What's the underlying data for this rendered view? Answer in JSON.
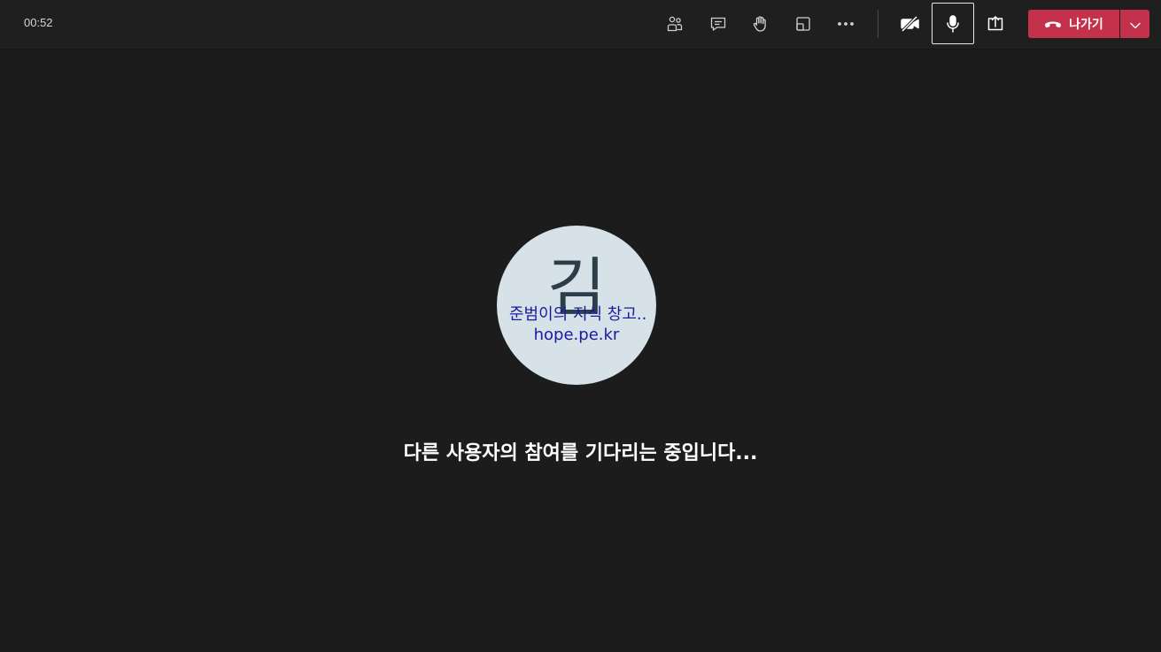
{
  "call": {
    "timer": "00:52"
  },
  "toolbar": {
    "buttons": [
      {
        "name": "show-participants",
        "icon": "people-icon"
      },
      {
        "name": "show-conversation",
        "icon": "chat-icon"
      },
      {
        "name": "raise-hand",
        "icon": "hand-icon"
      },
      {
        "name": "breakout-rooms",
        "icon": "rooms-icon"
      },
      {
        "name": "more-actions",
        "icon": "more-icon"
      },
      {
        "name": "camera-toggle",
        "icon": "camera-off-icon",
        "state": "off"
      },
      {
        "name": "mic-toggle",
        "icon": "mic-icon",
        "state": "on"
      },
      {
        "name": "share-content",
        "icon": "share-icon"
      }
    ],
    "leave_label": "나가기",
    "leave_color": "#c4314b"
  },
  "participant": {
    "initial": "김",
    "avatar_bg": "#d6e2e8",
    "watermark_line1": "준범이의 지식 창고..",
    "watermark_line2": "hope.pe.kr"
  },
  "status": {
    "message": "다른 사용자의 참여를 기다리는 중입니다..."
  }
}
